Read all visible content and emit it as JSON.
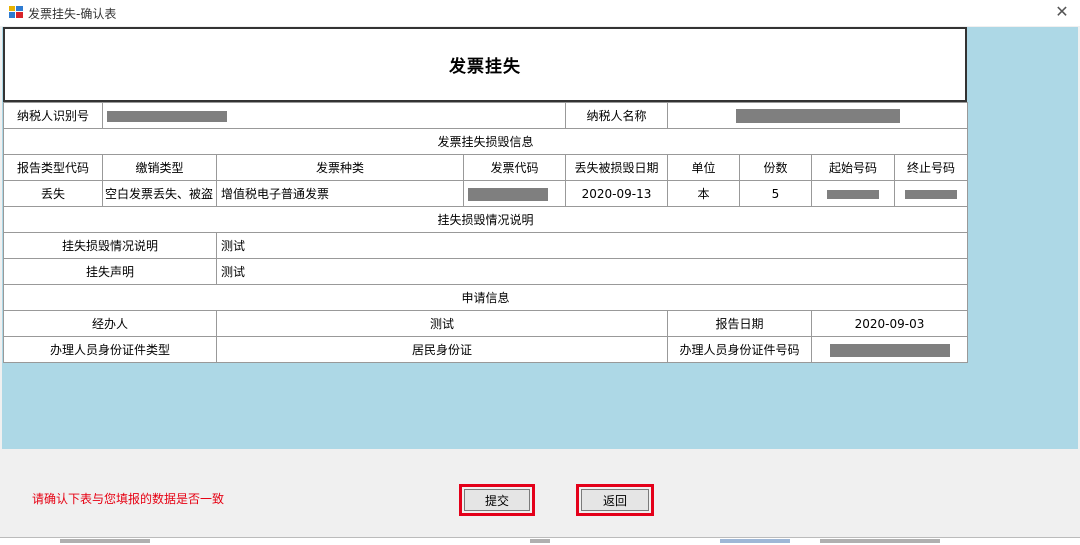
{
  "window": {
    "title": "发票挂失-确认表",
    "close_glyph": "✕"
  },
  "form": {
    "heading": "发票挂失",
    "taxpayer_id_label": "纳税人识别号",
    "taxpayer_name_label": "纳税人名称",
    "section_loss": "发票挂失损毁信息",
    "columns": [
      "报告类型代码",
      "缴销类型",
      "发票种类",
      "发票代码",
      "丢失被损毁日期",
      "单位",
      "份数",
      "起始号码",
      "终止号码"
    ],
    "row": {
      "report_type": "丢失",
      "cancel_type": "空白发票丢失、被盗",
      "invoice_kind": "增值税电子普通发票",
      "loss_date": "2020-09-13",
      "unit": "本",
      "count": "5"
    },
    "section_desc": "挂失损毁情况说明",
    "desc_label": "挂失损毁情况说明",
    "desc_value": "测试",
    "statement_label": "挂失声明",
    "statement_value": "测试",
    "section_apply": "申请信息",
    "handler_label": "经办人",
    "handler_value": "测试",
    "report_date_label": "报告日期",
    "report_date_value": "2020-09-03",
    "id_type_label": "办理人员身份证件类型",
    "id_type_value": "居民身份证",
    "id_no_label": "办理人员身份证件号码"
  },
  "footer": {
    "notice": "请确认下表与您填报的数据是否一致",
    "submit_label": "提交",
    "back_label": "返回"
  },
  "colors": {
    "highlight": "#e4001a",
    "background": "#add8e6",
    "notice": "#e60012"
  }
}
